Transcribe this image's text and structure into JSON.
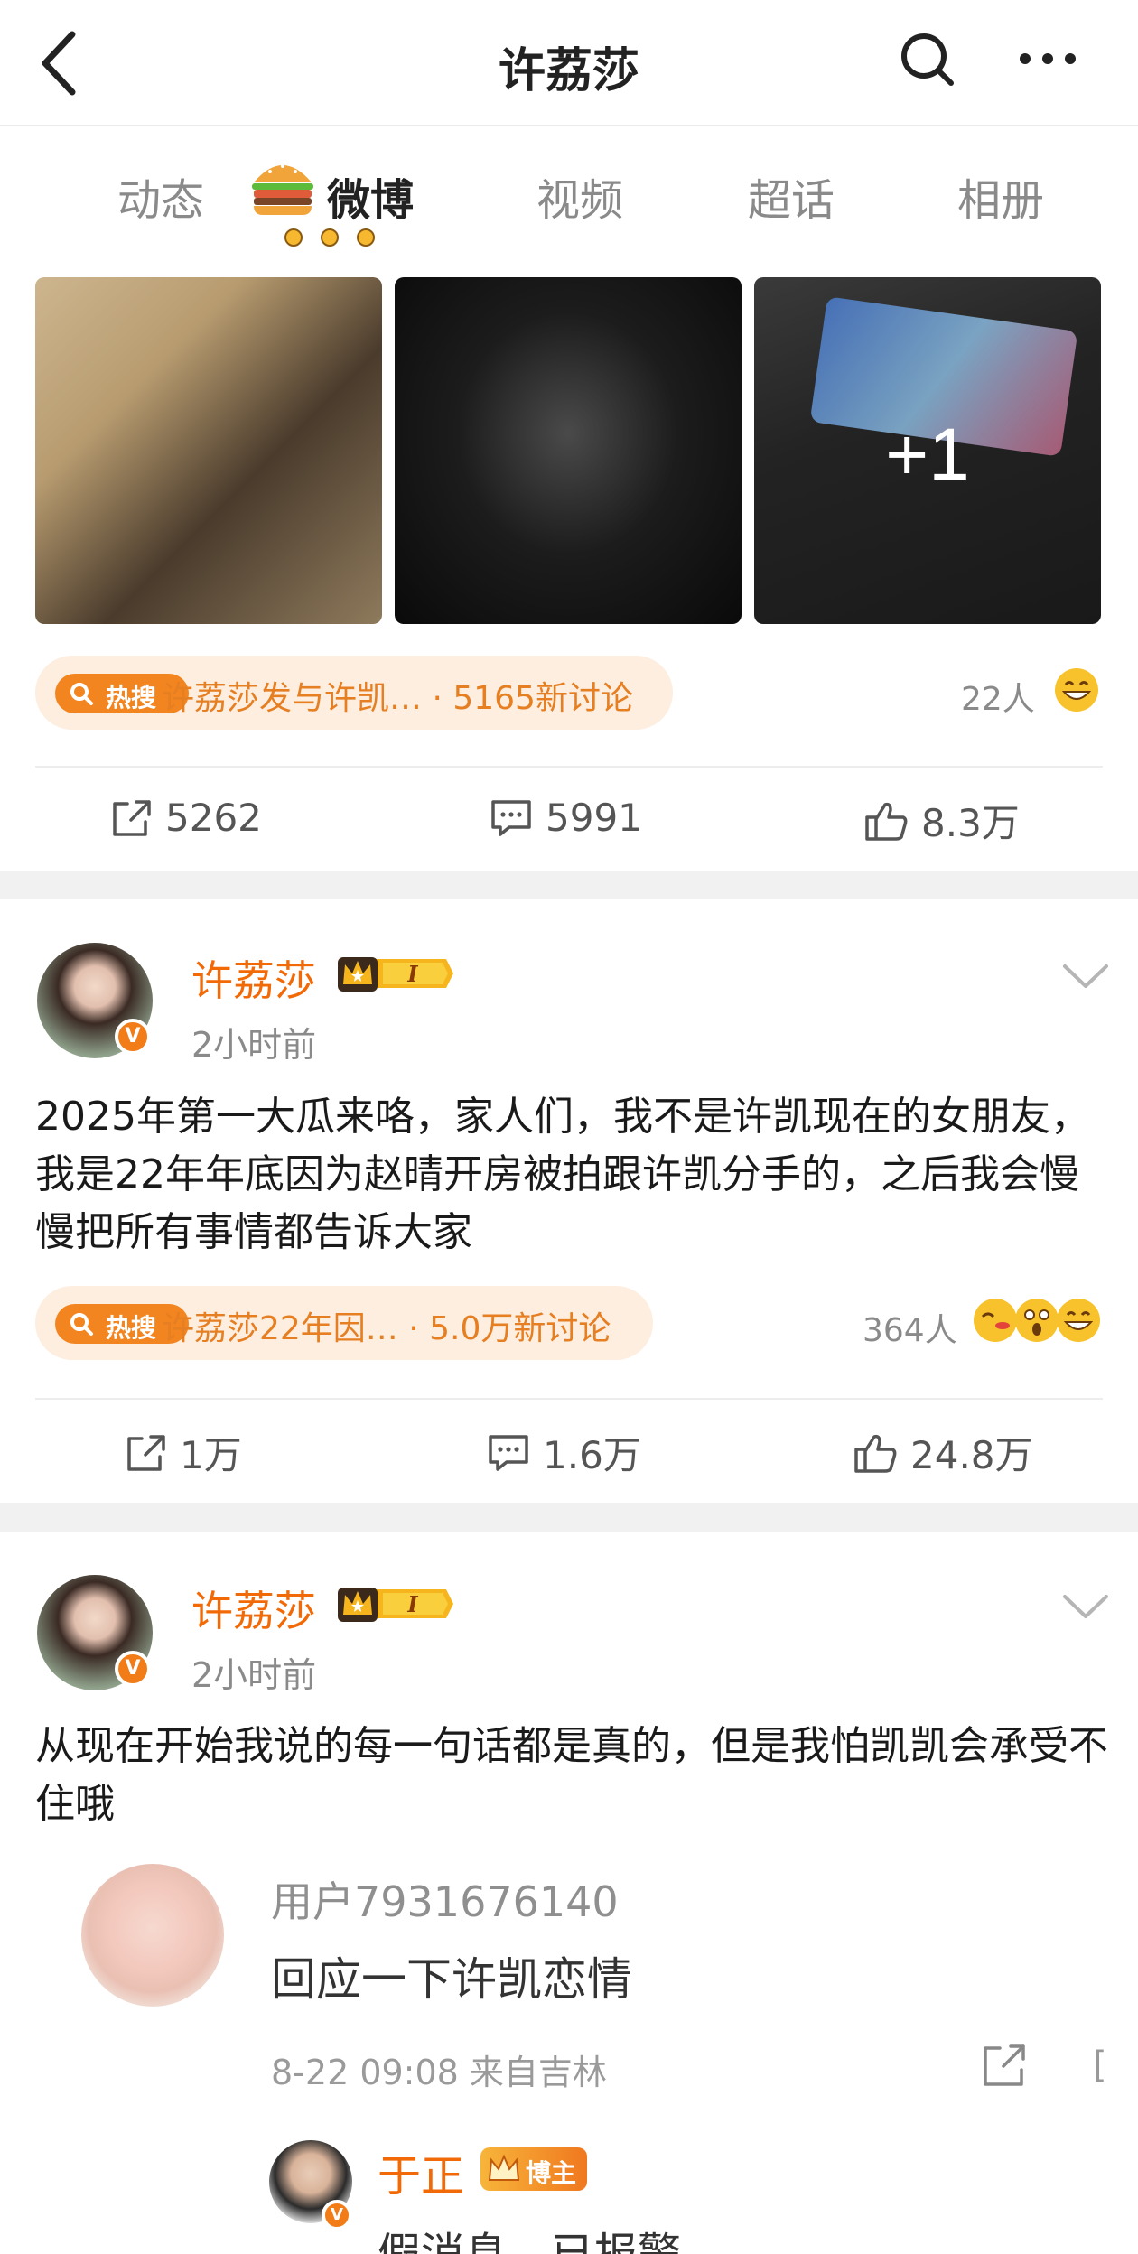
{
  "header": {
    "title": "许荔莎",
    "back_icon": "chevron-left-icon",
    "search_icon": "search-icon",
    "more_icon": "more-dots-icon"
  },
  "tabs": [
    "动态",
    "微博",
    "视频",
    "超话",
    "相册"
  ],
  "active_tab": "微博",
  "first_post": {
    "images_extra": "+1",
    "hot_badge": "热搜",
    "hot_topic": "许荔莎发与许凯… · 5165新讨论",
    "people": "22人",
    "reposts": "5262",
    "comments": "5991",
    "likes": "8.3万"
  },
  "post2": {
    "author": "许荔莎",
    "time": "2小时前",
    "verified": "V",
    "level": "I",
    "content": "2025年第一大瓜来咯，家人们，我不是许凯现在的女朋友，我是22年年底因为赵晴开房被拍跟许凯分手的，之后我会慢慢把所有事情都告诉大家",
    "hot_badge": "热搜",
    "hot_topic": "许荔莎22年因… · 5.0万新讨论",
    "people": "364人",
    "reposts": "1万",
    "comments": "1.6万",
    "likes": "24.8万"
  },
  "post3": {
    "author": "许荔莎",
    "time": "2小时前",
    "verified": "V",
    "level": "I",
    "content": "从现在开始我说的每一句话都是真的，但是我怕凯凯会承受不住哦",
    "embedded_comment": {
      "user": "用户7931676140",
      "text": "回应一下许凯恋情",
      "meta": "8-22 09:08  来自吉林",
      "edge": "[",
      "reply_user": "于正",
      "reply_badge": "博主",
      "reply_text": "假消息，已报警"
    }
  },
  "colors": {
    "accent_orange": "#f26a07",
    "hot_pill_bg": "#fdeee0",
    "hot_text": "#e67e22",
    "separator": "#f1f1f1"
  }
}
